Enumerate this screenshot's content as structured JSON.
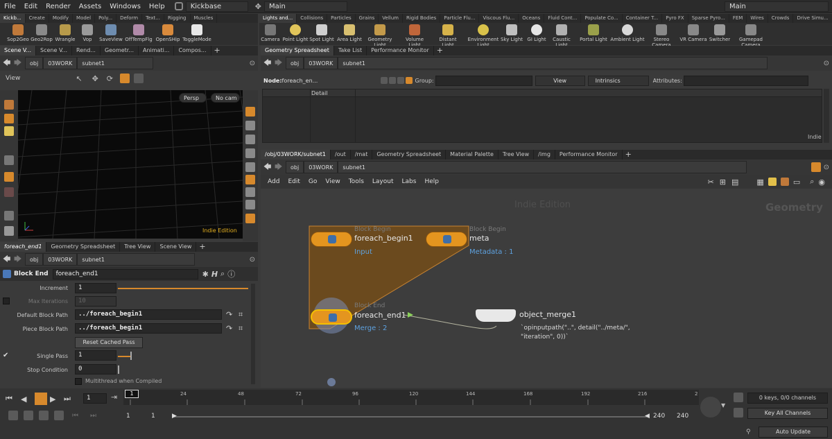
{
  "menubar": {
    "items": [
      "File",
      "Edit",
      "Render",
      "Assets",
      "Windows",
      "Help"
    ],
    "desktop": "Kickbase",
    "context": "Main",
    "right_context": "Main"
  },
  "shelf_left": {
    "tabs": [
      "Kickb...",
      "Create",
      "Modify",
      "Model",
      "Poly...",
      "Deform",
      "Text...",
      "Rigging",
      "Muscles"
    ],
    "tools": [
      "Sop2Geo",
      "Geo2Rop",
      "Wrangle",
      "Vop",
      "SaveView",
      "OffTempFlg",
      "OpenSHip",
      "ToggleMode"
    ]
  },
  "shelf_right": {
    "tabs": [
      "Lights and...",
      "Collisions",
      "Particles",
      "Grains",
      "Vellum",
      "Rigid Bodies",
      "Particle Flu...",
      "Viscous Flu...",
      "Oceans",
      "Fluid Cont...",
      "Populate Co...",
      "Container T...",
      "Pyro FX",
      "Sparse Pyro...",
      "FEM",
      "Wires",
      "Crowds",
      "Drive Simu..."
    ],
    "tools": [
      "Camera",
      "Point Light",
      "Spot Light",
      "Area Light",
      "Geometry Light",
      "Volume Light",
      "Distant Light",
      "Environment Light",
      "Sky Light",
      "GI Light",
      "Caustic Light",
      "Portal Light",
      "Ambient Light",
      "Stereo Camera",
      "VR Camera",
      "Switcher",
      "Gamepad Camera"
    ]
  },
  "viewport": {
    "tabs": [
      "Scene V...",
      "Scene V...",
      "Rend...",
      "Geometr...",
      "Animati...",
      "Compos..."
    ],
    "path": [
      "obj",
      "03WORK",
      "subnet1"
    ],
    "title": "View",
    "persp": "Persp",
    "cam": "No cam",
    "watermark": "Indie Edition"
  },
  "spreadsheet": {
    "tabs": [
      "Geometry Spreadsheet",
      "Take List",
      "Performance Monitor"
    ],
    "path": [
      "obj",
      "03WORK",
      "subnet1"
    ],
    "node_label": "Node:",
    "node_value": "foreach_en...",
    "group_label": "Group:",
    "view": "View",
    "intrinsics": "Intrinsics",
    "attributes_label": "Attributes:",
    "column": "Detail",
    "watermark": "Indie"
  },
  "network": {
    "tabs": [
      "/obj/03WORK/subnet1",
      "/out",
      "/mat",
      "Geometry Spreadsheet",
      "Material Palette",
      "Tree View",
      "/img",
      "Performance Monitor"
    ],
    "path": [
      "obj",
      "03WORK",
      "subnet1"
    ],
    "menu": [
      "Add",
      "Edit",
      "Go",
      "View",
      "Tools",
      "Layout",
      "Labs",
      "Help"
    ],
    "watermark": "Indie Edition",
    "context_label": "Geometry",
    "nodes": {
      "begin1": {
        "type": "Block Begin",
        "name": "foreach_begin1",
        "sub": "Input"
      },
      "meta": {
        "type": "Block Begin",
        "name": "meta",
        "sub": "Metadata : 1"
      },
      "end1": {
        "type": "Block End",
        "name": "foreach_end1",
        "sub": "Merge : 2"
      },
      "merge": {
        "name": "object_merge1",
        "expr_line1": "`opinputpath(\"..\", detail(\"../meta/\",",
        "expr_line2": "\"iteration\", 0))`"
      }
    }
  },
  "params": {
    "tabs": [
      "foreach_end1",
      "Geometry Spreadsheet",
      "Tree View",
      "Scene View"
    ],
    "path": [
      "obj",
      "03WORK",
      "subnet1"
    ],
    "node_type": "Block End",
    "node_name": "foreach_end1",
    "increment_label": "Increment",
    "increment_value": "1",
    "max_iter_label": "Max Iterations",
    "max_iter_value": "10",
    "default_path_label": "Default Block Path",
    "default_path_value": "../foreach_begin1",
    "piece_path_label": "Piece Block Path",
    "piece_path_value": "../foreach_begin1",
    "reset_button": "Reset Cached Pass",
    "single_pass_label": "Single Pass",
    "single_pass_value": "1",
    "stop_label": "Stop Condition",
    "stop_value": "0",
    "multithread_label": "Multithread when Compiled"
  },
  "timeline": {
    "frame": "1",
    "current_marker": "1",
    "ticks": [
      "24",
      "48",
      "72",
      "96",
      "120",
      "144",
      "168",
      "192",
      "216",
      "2"
    ],
    "start1": "1",
    "start2": "1",
    "end1": "240",
    "end2": "240",
    "keys_info": "0 keys, 0/0 channels",
    "key_all": "Key All Channels",
    "auto_update": "Auto Update"
  }
}
